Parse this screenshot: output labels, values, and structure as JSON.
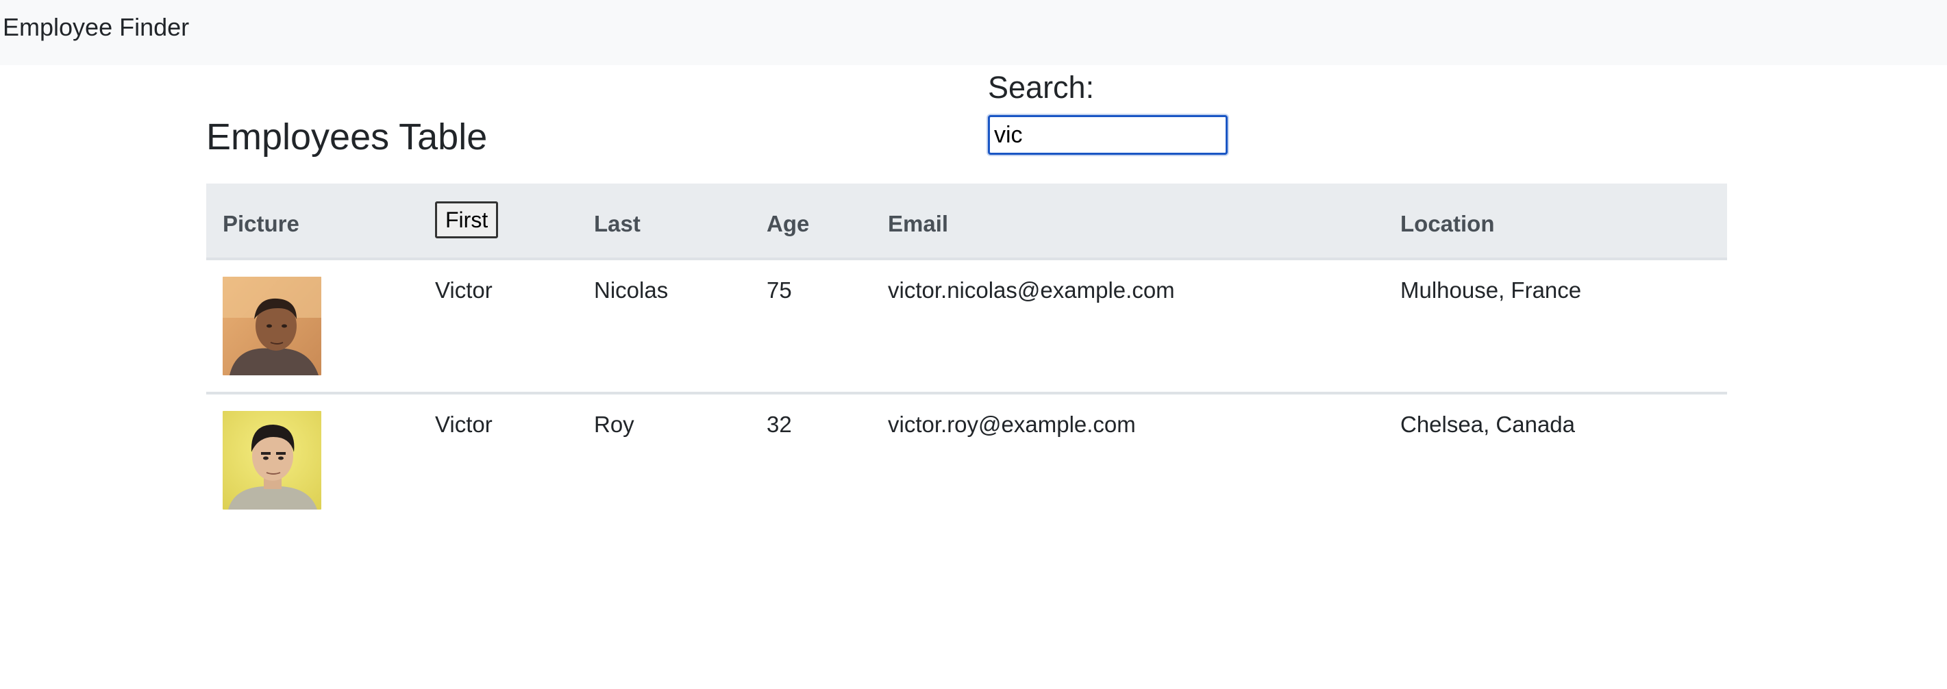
{
  "navbar": {
    "brand": "Employee Finder"
  },
  "main": {
    "title": "Employees Table",
    "search": {
      "label": "Search:",
      "value": "vic",
      "placeholder": ""
    }
  },
  "table": {
    "headers": {
      "picture": "Picture",
      "first": "First",
      "last": "Last",
      "age": "Age",
      "email": "Email",
      "location": "Location"
    },
    "rows": [
      {
        "first": "Victor",
        "last": "Nicolas",
        "age": "75",
        "email": "victor.nicolas@example.com",
        "location": "Mulhouse, France",
        "avatar": "person-photo"
      },
      {
        "first": "Victor",
        "last": "Roy",
        "age": "32",
        "email": "victor.roy@example.com",
        "location": "Chelsea, Canada",
        "avatar": "person-photo"
      }
    ]
  },
  "colors": {
    "navbar_bg": "#f8f9fa",
    "header_bg": "#e9ecef",
    "focus_border": "#1a56c4"
  }
}
